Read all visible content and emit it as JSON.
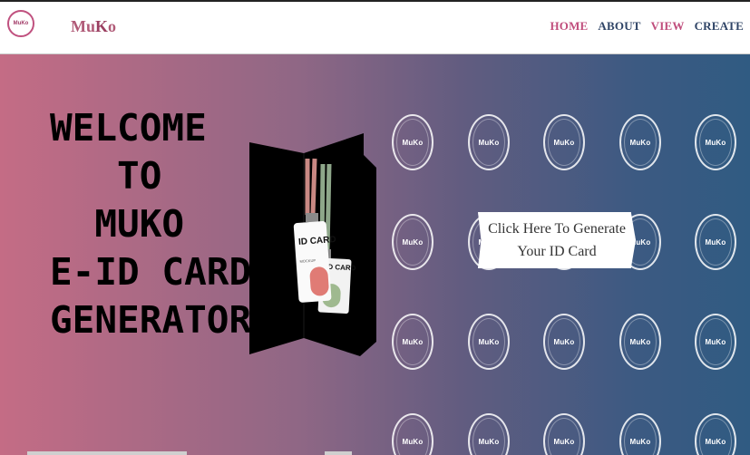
{
  "navbar": {
    "logo_text": "MuKo",
    "brand_prefix": "Mu",
    "brand_k": "K",
    "brand_suffix": "o",
    "links": [
      {
        "label": "HOME",
        "color": "pink"
      },
      {
        "label": "ABOUT",
        "color": "navy"
      },
      {
        "label": "VIEW",
        "color": "pink"
      },
      {
        "label": "CREATE",
        "color": "navy"
      }
    ]
  },
  "hero": {
    "welcome_lines": [
      "WELCOME",
      "   TO",
      "  MUKO",
      "E-ID CARD",
      "GENERATOR"
    ],
    "mockup": {
      "card1_title": "ID CARD",
      "card1_sub": "MOCKUP",
      "card2_title": "ID CARD"
    },
    "grid_logo_text": "MuKo",
    "cta_line1": "Click Here To Generate",
    "cta_line2": "Your ID Card"
  },
  "colors": {
    "gradient_left": "#c46c85",
    "gradient_right": "#305b82",
    "nav_pink": "#c04d7c",
    "nav_navy": "#2f4466"
  }
}
